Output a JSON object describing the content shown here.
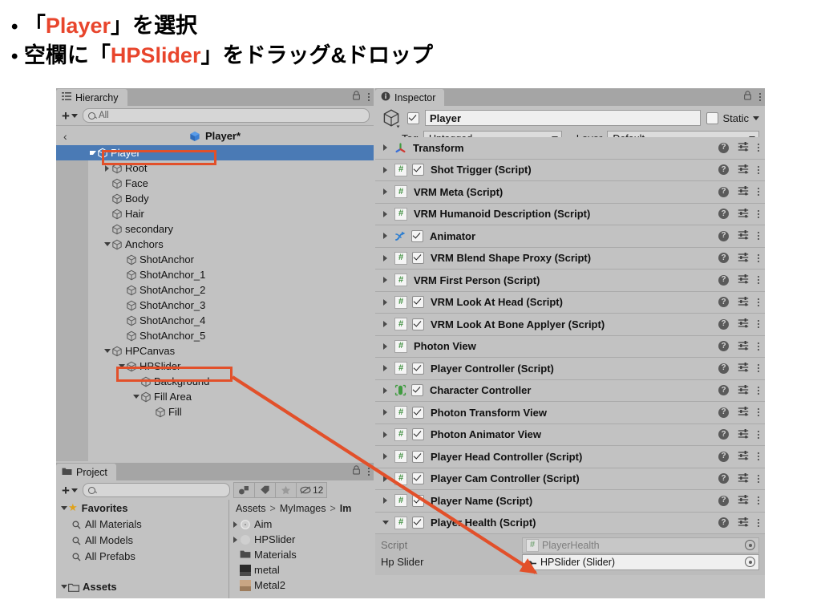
{
  "instructions": {
    "line1_bullet": "•",
    "line1_a": "「",
    "line1_hl": "Player",
    "line1_b": "」を選択",
    "line2_bullet": "•",
    "line2_a": "空欄に「",
    "line2_hl": "HPSlider",
    "line2_b": "」をドラッグ&ドロップ"
  },
  "colors": {
    "accent_red": "#e2502a",
    "selection_blue": "#4a7ab5",
    "panel_bg": "#c2c2c2",
    "tabbar_bg": "#a5a5a5"
  },
  "hierarchy": {
    "tab_label": "Hierarchy",
    "tab_icon": "hierarchy-icon",
    "lock_icon": "lock-icon",
    "menu_icon": "kebab-menu-icon",
    "add_label": "+",
    "search_placeholder": "All",
    "search_value": "",
    "breadcrumb": {
      "back_icon": "back-chevron-icon",
      "label": "Player*",
      "prefab_icon": "prefab-cube-icon"
    },
    "tree": [
      {
        "label": "Player",
        "depth": 0,
        "expander": "open",
        "selected": true,
        "annotated": true
      },
      {
        "label": "Root",
        "depth": 1,
        "expander": "closed",
        "selected": false,
        "annotated": false
      },
      {
        "label": "Face",
        "depth": 1,
        "expander": "none",
        "selected": false,
        "annotated": false
      },
      {
        "label": "Body",
        "depth": 1,
        "expander": "none",
        "selected": false,
        "annotated": false
      },
      {
        "label": "Hair",
        "depth": 1,
        "expander": "none",
        "selected": false,
        "annotated": false
      },
      {
        "label": "secondary",
        "depth": 1,
        "expander": "none",
        "selected": false,
        "annotated": false
      },
      {
        "label": "Anchors",
        "depth": 1,
        "expander": "open",
        "selected": false,
        "annotated": false
      },
      {
        "label": "ShotAnchor",
        "depth": 2,
        "expander": "none",
        "selected": false,
        "annotated": false
      },
      {
        "label": "ShotAnchor_1",
        "depth": 2,
        "expander": "none",
        "selected": false,
        "annotated": false
      },
      {
        "label": "ShotAnchor_2",
        "depth": 2,
        "expander": "none",
        "selected": false,
        "annotated": false
      },
      {
        "label": "ShotAnchor_3",
        "depth": 2,
        "expander": "none",
        "selected": false,
        "annotated": false
      },
      {
        "label": "ShotAnchor_4",
        "depth": 2,
        "expander": "none",
        "selected": false,
        "annotated": false
      },
      {
        "label": "ShotAnchor_5",
        "depth": 2,
        "expander": "none",
        "selected": false,
        "annotated": false
      },
      {
        "label": "HPCanvas",
        "depth": 1,
        "expander": "open",
        "selected": false,
        "annotated": false
      },
      {
        "label": "HPSlider",
        "depth": 2,
        "expander": "open",
        "selected": false,
        "annotated": true
      },
      {
        "label": "Background",
        "depth": 3,
        "expander": "none",
        "selected": false,
        "annotated": false
      },
      {
        "label": "Fill Area",
        "depth": 3,
        "expander": "open",
        "selected": false,
        "annotated": false
      },
      {
        "label": "Fill",
        "depth": 4,
        "expander": "none",
        "selected": false,
        "annotated": false
      }
    ]
  },
  "project": {
    "tab_label": "Project",
    "tab_icon": "folder-icon",
    "lock_icon": "lock-icon",
    "menu_icon": "kebab-menu-icon",
    "add_label": "+",
    "search_placeholder": "",
    "search_value": "",
    "toolbar_icons": [
      {
        "name": "type-filter-icon"
      },
      {
        "name": "label-filter-icon"
      },
      {
        "name": "favorite-star-icon"
      },
      {
        "name": "hidden-packages-icon",
        "count": "12"
      }
    ],
    "favorites": {
      "header": "Favorites",
      "items": [
        "All Materials",
        "All Models",
        "All Prefabs"
      ]
    },
    "assets_header": "Assets",
    "breadcrumb": [
      "Assets",
      "MyImages",
      "Im"
    ],
    "breadcrumb_sep": ">",
    "files": [
      {
        "label": "Aim",
        "type": "sprite",
        "expander": "closed"
      },
      {
        "label": "HPSlider",
        "type": "sprite",
        "expander": "closed"
      },
      {
        "label": "Materials",
        "type": "folder",
        "expander": "none"
      },
      {
        "label": "metal",
        "type": "material-dark",
        "expander": "none"
      },
      {
        "label": "Metal2",
        "type": "material-light",
        "expander": "none"
      }
    ]
  },
  "inspector": {
    "tab_label": "Inspector",
    "tab_icon": "info-icon",
    "lock_icon": "lock-icon",
    "menu_icon": "kebab-menu-icon",
    "object_icon": "gameobject-cube-icon",
    "active_checked": true,
    "name_value": "Player",
    "static_label": "Static",
    "static_checked": false,
    "tag_label": "Tag",
    "tag_value": "Untagged",
    "layer_label": "Layer",
    "layer_value": "Default",
    "row_icons": {
      "help": "?",
      "preset": "preset-icon",
      "menu": "kebab-menu-icon"
    },
    "components": [
      {
        "name": "Transform",
        "icon": "transform-axis-icon",
        "expander": "closed",
        "has_toggle": false,
        "enabled": false
      },
      {
        "name": "Shot Trigger (Script)",
        "icon": "script-icon",
        "expander": "closed",
        "has_toggle": true,
        "enabled": true
      },
      {
        "name": "VRM Meta (Script)",
        "icon": "script-icon",
        "expander": "closed",
        "has_toggle": false,
        "enabled": false
      },
      {
        "name": "VRM Humanoid Description (Script)",
        "icon": "script-icon",
        "expander": "closed",
        "has_toggle": false,
        "enabled": false
      },
      {
        "name": "Animator",
        "icon": "animator-icon",
        "expander": "closed",
        "has_toggle": true,
        "enabled": true
      },
      {
        "name": "VRM Blend Shape Proxy (Script)",
        "icon": "script-icon",
        "expander": "closed",
        "has_toggle": true,
        "enabled": true
      },
      {
        "name": "VRM First Person (Script)",
        "icon": "script-icon",
        "expander": "closed",
        "has_toggle": false,
        "enabled": false
      },
      {
        "name": "VRM Look At Head (Script)",
        "icon": "script-icon",
        "expander": "closed",
        "has_toggle": true,
        "enabled": true
      },
      {
        "name": "VRM Look At Bone Applyer (Script)",
        "icon": "script-icon",
        "expander": "closed",
        "has_toggle": true,
        "enabled": true
      },
      {
        "name": "Photon View",
        "icon": "script-icon",
        "expander": "closed",
        "has_toggle": false,
        "enabled": false
      },
      {
        "name": "Player Controller (Script)",
        "icon": "script-icon",
        "expander": "closed",
        "has_toggle": true,
        "enabled": true
      },
      {
        "name": "Character Controller",
        "icon": "character-capsule-icon",
        "expander": "closed",
        "has_toggle": true,
        "enabled": true
      },
      {
        "name": "Photon Transform View",
        "icon": "script-icon",
        "expander": "closed",
        "has_toggle": true,
        "enabled": true
      },
      {
        "name": "Photon Animator View",
        "icon": "script-icon",
        "expander": "closed",
        "has_toggle": true,
        "enabled": true
      },
      {
        "name": "Player Head Controller (Script)",
        "icon": "script-icon",
        "expander": "closed",
        "has_toggle": true,
        "enabled": true
      },
      {
        "name": "Player Cam Controller (Script)",
        "icon": "script-icon",
        "expander": "closed",
        "has_toggle": true,
        "enabled": true
      },
      {
        "name": "Player Name (Script)",
        "icon": "script-icon",
        "expander": "closed",
        "has_toggle": true,
        "enabled": true
      },
      {
        "name": "Player Health (Script)",
        "icon": "script-icon",
        "expander": "open",
        "has_toggle": true,
        "enabled": true
      }
    ],
    "player_health_fields": [
      {
        "label": "Script",
        "value": "PlayerHealth",
        "icon": "script-icon",
        "disabled": true,
        "picker": "object-picker-icon"
      },
      {
        "label": "Hp Slider",
        "value": "HPSlider (Slider)",
        "icon": "ui-slider-icon",
        "disabled": false,
        "picker": "object-picker-icon"
      }
    ]
  },
  "annotations": {
    "arrow_color": "#e2502a",
    "boxes": [
      {
        "name": "player-row-highlight-box"
      },
      {
        "name": "hpslider-row-highlight-box"
      }
    ],
    "arrow": {
      "name": "drag-drop-arrow"
    }
  }
}
